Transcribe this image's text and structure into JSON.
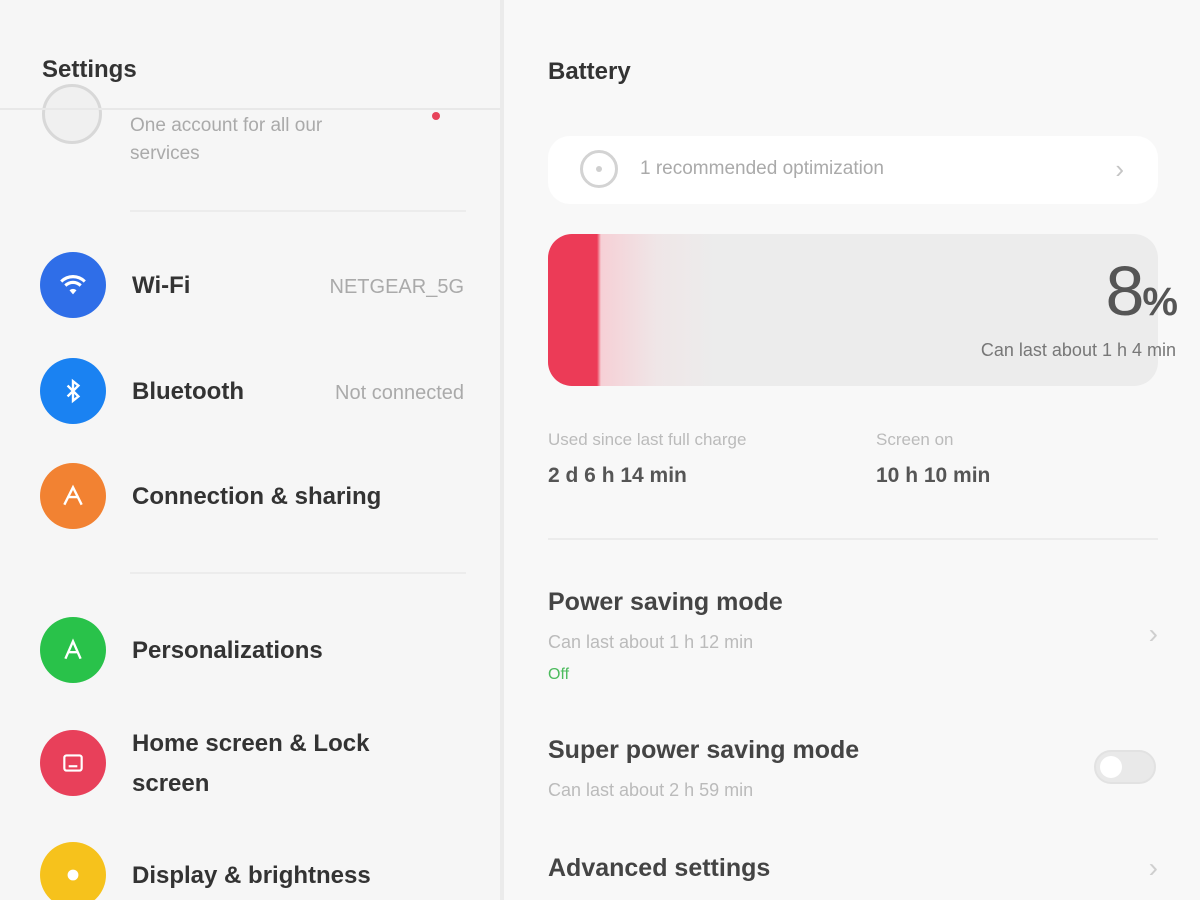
{
  "settings": {
    "title": "Settings",
    "account": {
      "subtitle": "One account for all our services"
    },
    "items": [
      {
        "label": "Wi-Fi",
        "value": "NETGEAR_5G",
        "icon": "wifi-icon",
        "color": "#2f6ee8"
      },
      {
        "label": "Bluetooth",
        "value": "Not connected",
        "icon": "bluetooth-icon",
        "color": "#1a82f2"
      },
      {
        "label": "Connection & sharing",
        "value": "",
        "icon": "share-icon",
        "color": "#f28232"
      },
      {
        "label": "Personalizations",
        "value": "",
        "icon": "personalization-icon",
        "color": "#29c24a"
      },
      {
        "label": "Home screen & Lock screen",
        "value": "",
        "icon": "home-screen-icon",
        "color": "#e8405a"
      },
      {
        "label": "Display & brightness",
        "value": "",
        "icon": "brightness-icon",
        "color": "#f6c21c"
      }
    ]
  },
  "battery": {
    "title": "Battery",
    "optimization": {
      "text": "1 recommended optimization"
    },
    "level_percent": 8,
    "level_value": "8",
    "level_unit": "%",
    "estimate": "Can last about 1 h 4 min",
    "accent_color": "#ec3b57",
    "stats": {
      "since_label": "Used since last full charge",
      "since_value": "2 d 6 h 14 min",
      "screen_label": "Screen on",
      "screen_value": "10 h 10 min"
    },
    "power_saving": {
      "title": "Power saving mode",
      "subtitle": "Can last about 1 h 12 min",
      "status": "Off"
    },
    "super_power_saving": {
      "title": "Super power saving mode",
      "subtitle": "Can last about 2 h 59 min",
      "enabled": false
    },
    "advanced": {
      "title": "Advanced settings"
    }
  }
}
